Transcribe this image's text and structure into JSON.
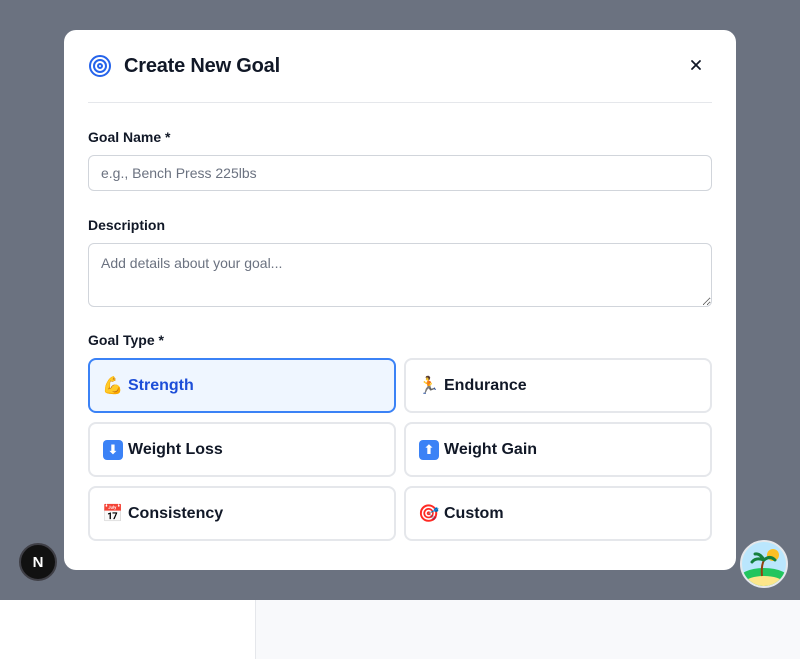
{
  "modal": {
    "title": "Create New Goal",
    "close_label": "×"
  },
  "form": {
    "goal_name": {
      "label": "Goal Name *",
      "placeholder": "e.g., Bench Press 225lbs",
      "value": ""
    },
    "description": {
      "label": "Description",
      "placeholder": "Add details about your goal...",
      "value": ""
    },
    "goal_type": {
      "label": "Goal Type *",
      "selected": "Strength",
      "options": [
        {
          "emoji": "💪",
          "label": "Strength",
          "selected": true,
          "icon": "flexed-biceps-icon"
        },
        {
          "emoji": "🏃",
          "label": "Endurance",
          "selected": false,
          "icon": "runner-icon"
        },
        {
          "emoji": "⬇",
          "label": "Weight Loss",
          "selected": false,
          "icon": "down-arrow-icon"
        },
        {
          "emoji": "⬆",
          "label": "Weight Gain",
          "selected": false,
          "icon": "up-arrow-icon"
        },
        {
          "emoji": "📅",
          "label": "Consistency",
          "selected": false,
          "icon": "calendar-icon"
        },
        {
          "emoji": "🎯",
          "label": "Custom",
          "selected": false,
          "icon": "dart-target-icon"
        }
      ]
    }
  },
  "badges": {
    "next_badge_letter": "N"
  },
  "colors": {
    "accent": "#3b82f6",
    "accent_text": "#1d4ed8",
    "selected_bg": "#eff6ff",
    "backdrop": "#6b7280"
  }
}
